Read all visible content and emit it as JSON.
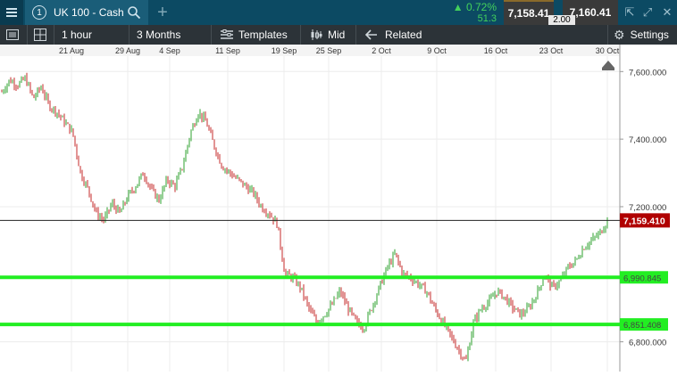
{
  "window": {
    "tab_number": "1",
    "tab_title": "UK 100 - Cash",
    "change_pct": "0.72%",
    "change_pts": "51.3",
    "sell_price": "7,158.41",
    "buy_price": "7,160.41",
    "spread": "2.00"
  },
  "toolbar": {
    "interval": "1 hour",
    "range": "3 Months",
    "templates": "Templates",
    "price_type": "Mid",
    "related": "Related",
    "settings": "Settings"
  },
  "colors": {
    "header_bg": "#0c4a63",
    "toolbar_bg": "#2c3338",
    "up": "#2ca02c",
    "down": "#c62828",
    "level_line": "#22ee22",
    "price_tag": "#b00000"
  },
  "chart_data": {
    "type": "line",
    "x_tick_labels": [
      "21 Aug",
      "29 Aug",
      "4 Sep",
      "11 Sep",
      "19 Sep",
      "25 Sep",
      "2 Oct",
      "9 Oct",
      "16 Oct",
      "23 Oct",
      "30 Oct"
    ],
    "y_tick_labels": [
      "7,600.000",
      "7,400.000",
      "7,200.000",
      "6,800.000"
    ],
    "y_ticks": [
      7600,
      7400,
      7200,
      6800
    ],
    "ylim": [
      6712,
      7643
    ],
    "current_price": 7159.41,
    "current_price_label": "7,159.410",
    "levels": [
      {
        "value": 6990.845,
        "label": "6,990.845"
      },
      {
        "value": 6851.408,
        "label": "6,851.408"
      }
    ],
    "series": [
      {
        "values": [
          7540,
          7575,
          7560,
          7580,
          7520,
          7555,
          7500,
          7480,
          7450,
          7420,
          7300,
          7250,
          7180,
          7160,
          7210,
          7180,
          7230,
          7260,
          7300,
          7250,
          7220,
          7280,
          7260,
          7320,
          7420,
          7480,
          7450,
          7380,
          7320,
          7300,
          7280,
          7260,
          7240,
          7200,
          7180,
          7150,
          7000,
          6990,
          6960,
          6900,
          6860,
          6880,
          6910,
          6950,
          6900,
          6860,
          6840,
          6900,
          6960,
          7020,
          7060,
          7000,
          6990,
          6970,
          6950,
          6900,
          6860,
          6820,
          6780,
          6740,
          6860,
          6900,
          6920,
          6950,
          6930,
          6900,
          6880,
          6900,
          6940,
          7000,
          6960,
          6980,
          7020,
          7040,
          7080,
          7100,
          7120,
          7159
        ]
      }
    ]
  }
}
